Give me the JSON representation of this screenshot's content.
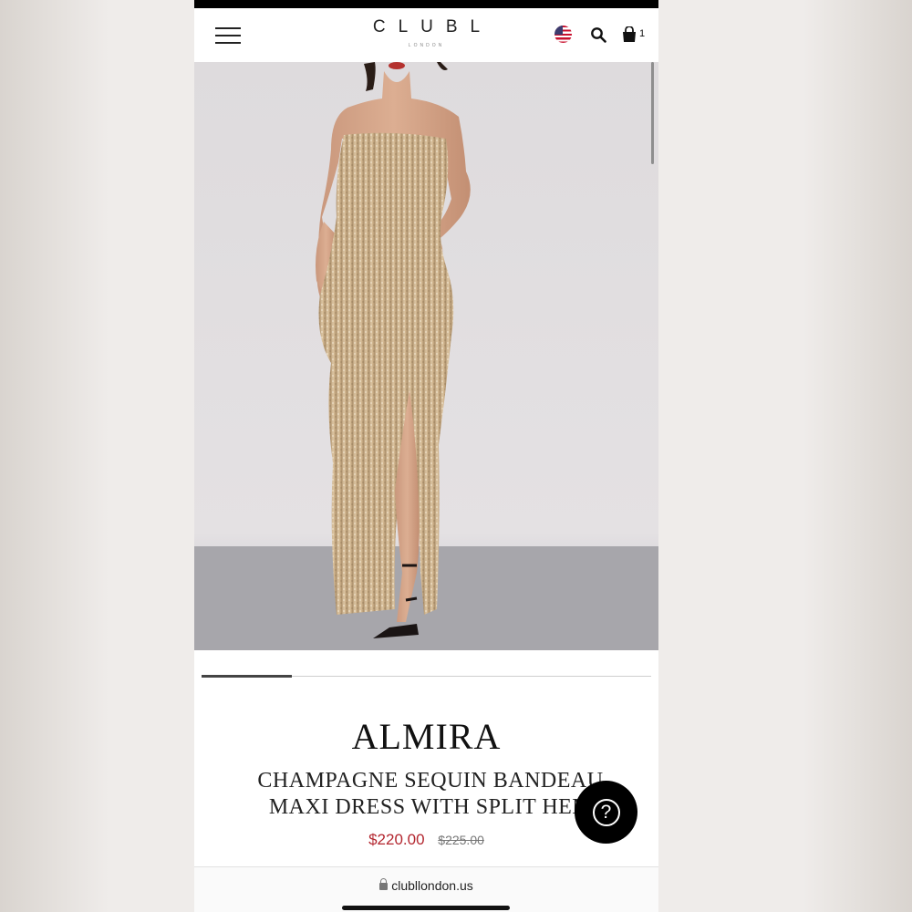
{
  "header": {
    "logo": "CLUBL",
    "logo_sub": "LONDON",
    "cart_count": "1",
    "icons": [
      "menu-icon",
      "us-flag-icon",
      "search-icon",
      "bag-icon"
    ]
  },
  "product": {
    "name": "ALMIRA",
    "description_line1": "CHAMPAGNE SEQUIN BANDEAU",
    "description_line2": "MAXI DRESS WITH SPLIT HEM",
    "price_current": "$220.00",
    "price_old": "$225.00"
  },
  "carousel": {
    "progress": 0.2
  },
  "help": {
    "label": "?"
  },
  "browser": {
    "url": "clubllondon.us"
  },
  "colors": {
    "price_sale": "#b3262f",
    "dress": "#c9ae88",
    "accent": "#000000"
  }
}
